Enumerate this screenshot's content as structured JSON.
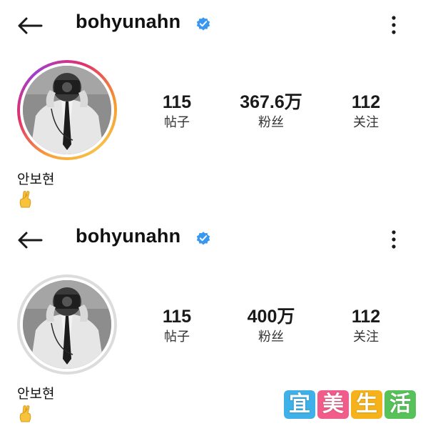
{
  "panels": [
    {
      "username": "bohyunahn",
      "stats": [
        {
          "value": "115",
          "label": "帖子"
        },
        {
          "value": "367.6万",
          "label": "粉丝"
        },
        {
          "value": "112",
          "label": "关注"
        }
      ],
      "display_name": "안보현",
      "bio_emoji": "crossed-fingers-emoji",
      "avatar_ring": "story-gradient"
    },
    {
      "username": "bohyunahn",
      "stats": [
        {
          "value": "115",
          "label": "帖子"
        },
        {
          "value": "400万",
          "label": "粉丝"
        },
        {
          "value": "112",
          "label": "关注"
        }
      ],
      "display_name": "안보현",
      "bio_emoji": "crossed-fingers-emoji",
      "avatar_ring": "plain-gray"
    }
  ],
  "icons": {
    "back": "arrow-left-icon",
    "verified": "verified-badge-icon",
    "more": "more-vertical-icon"
  },
  "colors": {
    "verified_blue": "#3897f0",
    "text": "#1a1a1a",
    "watermark": [
      "#3fb0e8",
      "#f25c8a",
      "#f5b21a",
      "#57c25a"
    ]
  },
  "watermark": {
    "chars": [
      "宜",
      "美",
      "生",
      "活"
    ]
  }
}
